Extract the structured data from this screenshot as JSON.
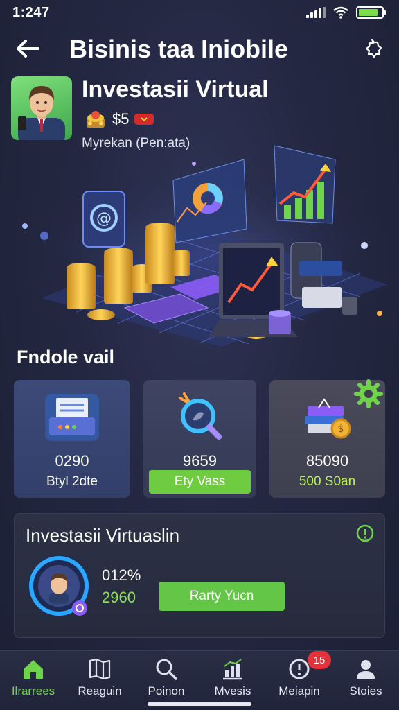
{
  "status": {
    "time": "1:247",
    "battery_level": 0.85
  },
  "header": {
    "title": "Bisinis taa Iniobile",
    "back_icon": "arrow-left-icon",
    "settings_icon": "gear-icon"
  },
  "profile": {
    "title": "Investasii Virtual",
    "coins": "$5",
    "subtitle": "Myrekan (Pen:ata)"
  },
  "section": {
    "title": "Fndole vail"
  },
  "cards": [
    {
      "value": "0290",
      "sub": "Btyl 2dte",
      "icon": "printer-icon"
    },
    {
      "value": "9659",
      "button": "Ety Vass",
      "icon": "magnifier-icon"
    },
    {
      "value": "85090",
      "sub": "500 S0an",
      "icon": "books-coin-icon"
    }
  ],
  "invest": {
    "title": "Investasii Virtuaslin",
    "percent": "012%",
    "amount": "2960",
    "button": "Rarty Yucn"
  },
  "nav": [
    {
      "label": "Ilrarrees",
      "icon": "home-icon",
      "active": true
    },
    {
      "label": "Reaguin",
      "icon": "map-icon"
    },
    {
      "label": "Poinon",
      "icon": "search-icon"
    },
    {
      "label": "Mvesis",
      "icon": "chart-icon"
    },
    {
      "label": "Meiapin",
      "icon": "alert-icon",
      "badge": "15"
    },
    {
      "label": "Stoies",
      "icon": "user-icon"
    }
  ],
  "colors": {
    "accent_green": "#6fcb3f",
    "badge_red": "#e2323a",
    "background": "#232741"
  }
}
